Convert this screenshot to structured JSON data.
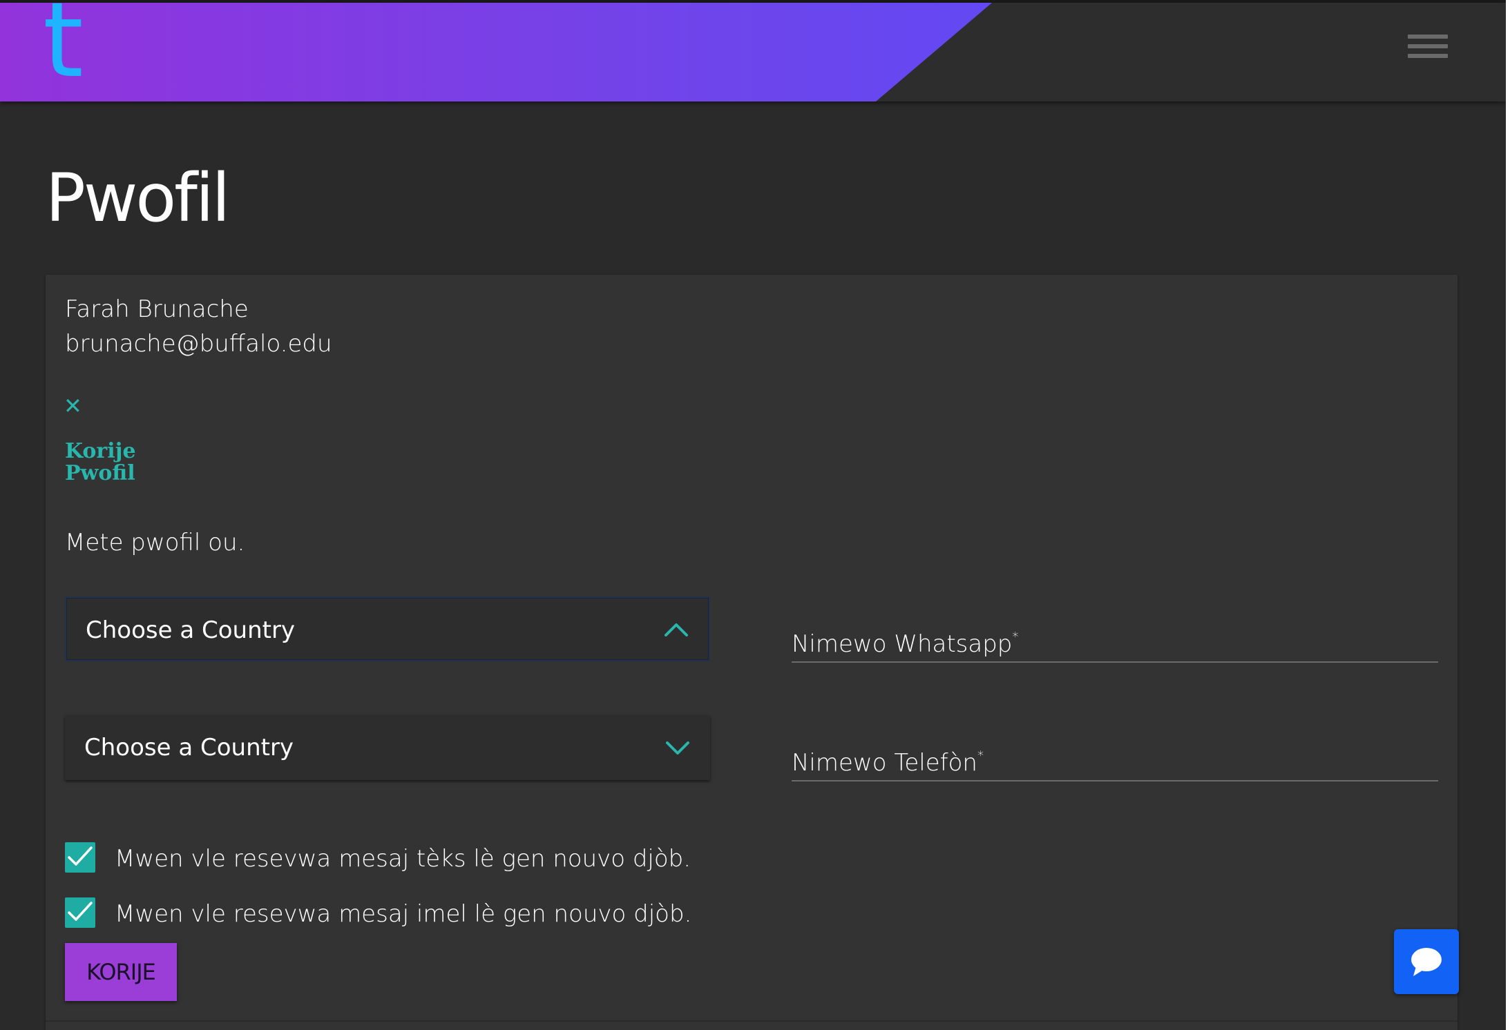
{
  "brand": {
    "logo_letter": "t",
    "gradient_start": "#9233dc",
    "gradient_end": "#6348f3",
    "logo_color": "#1fb4ff"
  },
  "header": {
    "menu_icon": "hamburger-menu-icon"
  },
  "page": {
    "title": "Pwofil"
  },
  "user": {
    "name": "Farah Brunache",
    "email": "brunache@buffalo.edu"
  },
  "edit_panel": {
    "close_icon": "close-icon",
    "title": "Korije Pwofil",
    "intro": "Mete pwofil ou."
  },
  "form": {
    "country_select_whatsapp": {
      "label": "Choose a Country",
      "state": "open",
      "icon": "chevron-up-icon"
    },
    "country_select_phone": {
      "label": "Choose a Country",
      "state": "closed",
      "icon": "chevron-down-icon"
    },
    "whatsapp_field": {
      "label": "Nimewo Whatsapp",
      "required_mark": "*"
    },
    "phone_field": {
      "label": "Nimewo Telefòn",
      "required_mark": "*"
    },
    "checkboxes": [
      {
        "label": "Mwen vle resevwa mesaj tèks lè gen nouvo djòb.",
        "checked": true
      },
      {
        "label": "Mwen vle resevwa mesaj imel lè gen nouvo djòb.",
        "checked": true
      }
    ],
    "submit_label": "KORIJE"
  },
  "chat": {
    "icon": "chat-bubble-icon",
    "color": "#1262f5"
  },
  "colors": {
    "accent": "#29b6ac",
    "button": "#9b3ed8",
    "background": "#2a2a2a",
    "card": "#333333"
  }
}
